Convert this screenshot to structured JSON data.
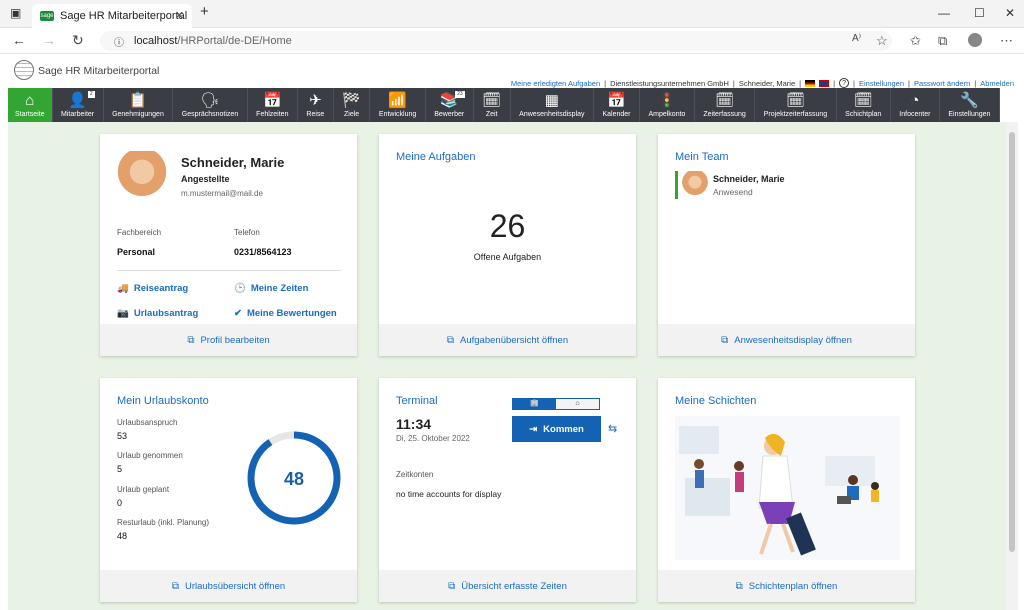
{
  "browser": {
    "tab_title": "Sage HR Mitarbeiterportal",
    "url_host": "localhost",
    "url_path": "/HRPortal/de-DE/Home",
    "favicon_text": "sage"
  },
  "header": {
    "app_name": "Sage HR Mitarbeiterportal",
    "links": {
      "done_tasks": "Meine erledigten Aufgaben",
      "company": "Dienstleistungsunternehmen GmbH",
      "user": "Schneider, Marie",
      "settings": "Einstellungen",
      "change_password": "Passwort ändern",
      "logout": "Abmelden"
    }
  },
  "nav": {
    "items": [
      {
        "label": "Startseite",
        "icon": "home-icon",
        "glyph": "⌂"
      },
      {
        "label": "Mitarbeiter",
        "icon": "user-icon",
        "glyph": "👤",
        "badge": "2"
      },
      {
        "label": "Genehmigungen",
        "icon": "clipboard-icon",
        "glyph": "📋"
      },
      {
        "label": "Gesprächsnotizen",
        "icon": "head-icon",
        "glyph": "🗣"
      },
      {
        "label": "Fehlzeiten",
        "icon": "calendar-icon",
        "glyph": "📅"
      },
      {
        "label": "Reise",
        "icon": "plane-icon",
        "glyph": "✈"
      },
      {
        "label": "Ziele",
        "icon": "flag-icon",
        "glyph": "🏁"
      },
      {
        "label": "Entwicklung",
        "icon": "chart-icon",
        "glyph": "📶"
      },
      {
        "label": "Bewerber",
        "icon": "applicant-icon",
        "glyph": "📚",
        "badge": "23"
      },
      {
        "label": "Zeit",
        "icon": "clock-calendar-icon",
        "glyph": "🗓"
      },
      {
        "label": "Anwesenheitsdisplay",
        "icon": "grid-icon",
        "glyph": "▦"
      },
      {
        "label": "Kalender",
        "icon": "calendar-icon",
        "glyph": "📅"
      },
      {
        "label": "Ampelkonto",
        "icon": "traffic-light-icon",
        "glyph": "🚦"
      },
      {
        "label": "Zeiterfassung",
        "icon": "time-entry-icon",
        "glyph": "🗓"
      },
      {
        "label": "Projektzeiterfassung",
        "icon": "project-time-icon",
        "glyph": "🗓"
      },
      {
        "label": "Schichtplan",
        "icon": "shift-plan-icon",
        "glyph": "🗓"
      },
      {
        "label": "Infocenter",
        "icon": "pie-icon",
        "glyph": "◔"
      },
      {
        "label": "Einstellungen",
        "icon": "wrench-icon",
        "glyph": "🔧"
      }
    ]
  },
  "profile": {
    "name": "Schneider, Marie",
    "role": "Angestellte",
    "email": "m.mustermail@mail.de",
    "dept_label": "Fachbereich",
    "dept_value": "Personal",
    "phone_label": "Telefon",
    "phone_value": "0231/8564123",
    "link_travel": "Reiseantrag",
    "link_times": "Meine Zeiten",
    "link_vacation": "Urlaubsantrag",
    "link_ratings": "Meine Bewertungen",
    "footer": "Profil bearbeiten"
  },
  "tasks": {
    "title": "Meine Aufgaben",
    "count": "26",
    "caption": "Offene Aufgaben",
    "footer": "Aufgabenübersicht öffnen"
  },
  "team": {
    "title": "Mein Team",
    "member_name": "Schneider, Marie",
    "member_status": "Anwesend",
    "status_color": "#33a532",
    "footer": "Anwesenheitsdisplay öffnen"
  },
  "vacation": {
    "title": "Mein Urlaubskonto",
    "rows": [
      {
        "label": "Urlaubsanspruch",
        "value": "53"
      },
      {
        "label": "Urlaub genommen",
        "value": "5"
      },
      {
        "label": "Urlaub geplant",
        "value": "0"
      },
      {
        "label": "Resturlaub (inkl. Planung)",
        "value": "48"
      }
    ],
    "ring_value": "48",
    "ring_fraction": 0.906,
    "footer": "Urlaubsübersicht öffnen"
  },
  "terminal": {
    "title": "Terminal",
    "time": "11:34",
    "date": "Di, 25. Oktober 2022",
    "button": "Kommen",
    "accounts_label": "Zeitkonten",
    "accounts_value": "no time accounts for display",
    "footer": "Übersicht erfasste Zeiten"
  },
  "shifts": {
    "title": "Meine Schichten",
    "footer": "Schichtenplan öffnen"
  },
  "colors": {
    "accent": "#1b6cc4",
    "nav_bg": "#3a3d44",
    "active": "#33a532",
    "bg": "#e9f3e5"
  }
}
